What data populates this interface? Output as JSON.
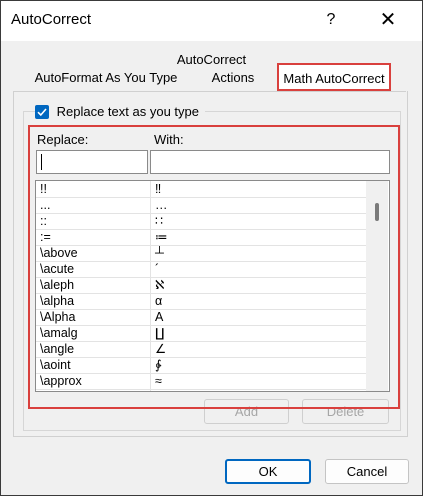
{
  "window": {
    "title": "AutoCorrect",
    "help_glyph": "?",
    "close_glyph": "✕"
  },
  "tabs": {
    "caption": "AutoCorrect",
    "items": [
      "AutoFormat As You Type",
      "Actions",
      "Math AutoCorrect"
    ],
    "selected": "Math AutoCorrect"
  },
  "group": {
    "checkbox_label": "Replace text as you type",
    "checked": true
  },
  "columns": {
    "replace": "Replace:",
    "with": "With:"
  },
  "inputs": {
    "replace_value": "",
    "with_value": ""
  },
  "entries": [
    {
      "replace": "!!",
      "with": "‼"
    },
    {
      "replace": "...",
      "with": "…"
    },
    {
      "replace": "::",
      "with": "∷"
    },
    {
      "replace": ":=",
      "with": "≔"
    },
    {
      "replace": "\\above",
      "with": "┴"
    },
    {
      "replace": "\\acute",
      "with": "´"
    },
    {
      "replace": "\\aleph",
      "with": "ℵ"
    },
    {
      "replace": "\\alpha",
      "with": "α"
    },
    {
      "replace": "\\Alpha",
      "with": "A"
    },
    {
      "replace": "\\amalg",
      "with": "∐"
    },
    {
      "replace": "\\angle",
      "with": "∠"
    },
    {
      "replace": "\\aoint",
      "with": "∳"
    },
    {
      "replace": "\\approx",
      "with": "≈"
    }
  ],
  "buttons": {
    "add": "Add",
    "delete": "Delete",
    "ok": "OK",
    "cancel": "Cancel"
  },
  "colors": {
    "accent": "#0067c0",
    "highlight": "#d9403d"
  }
}
